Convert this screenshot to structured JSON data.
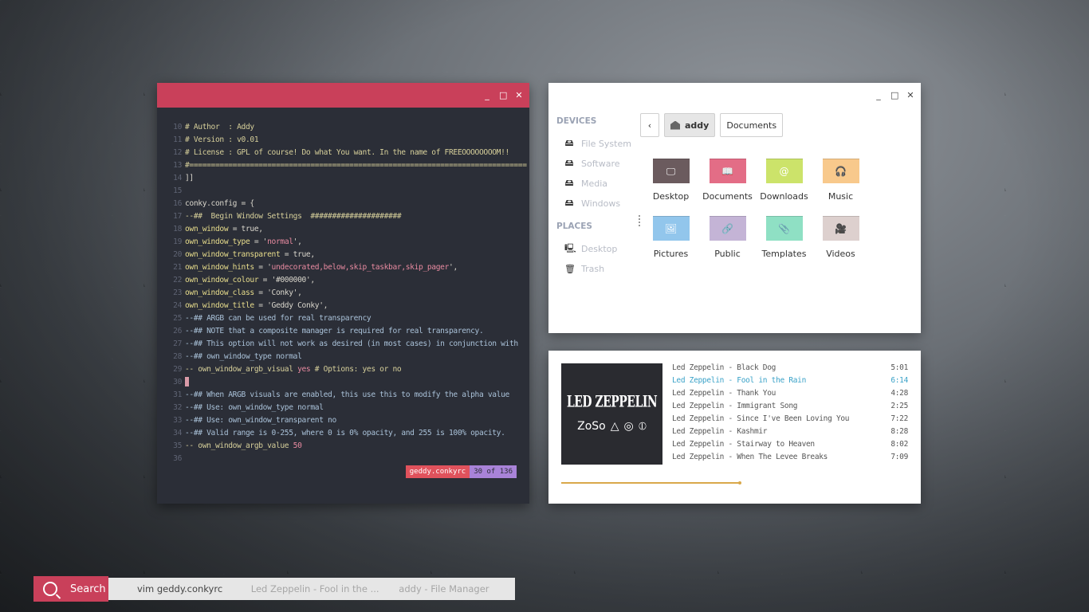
{
  "terminal": {
    "controls": {
      "min": "_",
      "max": "□",
      "close": "✕"
    },
    "lines": [
      {
        "n": "10",
        "parts": [
          {
            "c": "c-cmt",
            "t": "# Author  : Addy"
          }
        ]
      },
      {
        "n": "11",
        "parts": [
          {
            "c": "c-cmt",
            "t": "# Version : v0.01"
          }
        ]
      },
      {
        "n": "12",
        "parts": [
          {
            "c": "c-cmt",
            "t": "# License : GPL of course! Do what You want. In the name of FREEOOOOOOOOM!!"
          }
        ]
      },
      {
        "n": "13",
        "parts": [
          {
            "c": "c-cmt",
            "t": "#=============================================================================="
          }
        ]
      },
      {
        "n": "14",
        "parts": [
          {
            "c": "c-plain",
            "t": "]]"
          }
        ]
      },
      {
        "n": "15",
        "parts": []
      },
      {
        "n": "16",
        "parts": [
          {
            "c": "c-plain",
            "t": "conky.config = {"
          }
        ]
      },
      {
        "n": "17",
        "parts": [
          {
            "c": "c-cmt",
            "t": "--##  Begin Window Settings  #####################"
          }
        ]
      },
      {
        "n": "18",
        "parts": [
          {
            "c": "c-var",
            "t": "own_window"
          },
          {
            "c": "c-plain",
            "t": " = true,"
          }
        ]
      },
      {
        "n": "19",
        "parts": [
          {
            "c": "c-var",
            "t": "own_window_type"
          },
          {
            "c": "c-plain",
            "t": " = '"
          },
          {
            "c": "c-str",
            "t": "normal"
          },
          {
            "c": "c-plain",
            "t": "',"
          }
        ]
      },
      {
        "n": "20",
        "parts": [
          {
            "c": "c-var",
            "t": "own_window_transparent"
          },
          {
            "c": "c-plain",
            "t": " = true,"
          }
        ]
      },
      {
        "n": "21",
        "parts": [
          {
            "c": "c-var",
            "t": "own_window_hints"
          },
          {
            "c": "c-plain",
            "t": " = '"
          },
          {
            "c": "c-str",
            "t": "undecorated,below,skip_taskbar,skip_pager"
          },
          {
            "c": "c-plain",
            "t": "',"
          }
        ]
      },
      {
        "n": "22",
        "parts": [
          {
            "c": "c-var",
            "t": "own_window_colour"
          },
          {
            "c": "c-plain",
            "t": " = '#000000',"
          }
        ]
      },
      {
        "n": "23",
        "parts": [
          {
            "c": "c-var",
            "t": "own_window_class"
          },
          {
            "c": "c-plain",
            "t": " = 'Conky',"
          }
        ]
      },
      {
        "n": "24",
        "parts": [
          {
            "c": "c-var",
            "t": "own_window_title"
          },
          {
            "c": "c-plain",
            "t": " = 'Geddy Conky',"
          }
        ]
      },
      {
        "n": "25",
        "parts": [
          {
            "c": "c-cmt2",
            "t": "--## ARGB can be used for real transparency"
          }
        ]
      },
      {
        "n": "26",
        "parts": [
          {
            "c": "c-cmt2",
            "t": "--## NOTE that a composite manager is required for real transparency."
          }
        ]
      },
      {
        "n": "27",
        "parts": [
          {
            "c": "c-cmt2",
            "t": "--## This option will not work as desired (in most cases) in conjunction with"
          }
        ]
      },
      {
        "n": "28",
        "parts": [
          {
            "c": "c-cmt2",
            "t": "--## own_window_type normal"
          }
        ]
      },
      {
        "n": "29",
        "parts": [
          {
            "c": "c-cmt",
            "t": "-- own_window_argb_visual "
          },
          {
            "c": "c-str",
            "t": "yes"
          },
          {
            "c": "c-cmt",
            "t": " # Options: yes or no"
          }
        ]
      },
      {
        "n": "30",
        "cursor": true,
        "parts": []
      },
      {
        "n": "31",
        "parts": [
          {
            "c": "c-cmt2",
            "t": "--## When ARGB visuals are enabled, this use this to modify the alpha value"
          }
        ]
      },
      {
        "n": "32",
        "parts": [
          {
            "c": "c-cmt2",
            "t": "--## Use: own_window_type normal"
          }
        ]
      },
      {
        "n": "33",
        "parts": [
          {
            "c": "c-cmt2",
            "t": "--## Use: own_window_transparent no"
          }
        ]
      },
      {
        "n": "34",
        "parts": [
          {
            "c": "c-cmt2",
            "t": "--## Valid range is 0-255, where 0 is 0% opacity, and 255 is 100% opacity."
          }
        ]
      },
      {
        "n": "35",
        "parts": [
          {
            "c": "c-cmt",
            "t": "-- own_window_argb_value "
          },
          {
            "c": "c-str",
            "t": "50"
          }
        ]
      },
      {
        "n": "36",
        "parts": []
      }
    ],
    "status": {
      "filename": "geddy.conkyrc",
      "position": "30 of 136"
    }
  },
  "file_manager": {
    "controls": {
      "min": "_",
      "max": "□",
      "close": "✕"
    },
    "devices_heading": "DEVICES",
    "devices": [
      "File System",
      "Software",
      "Media",
      "Windows"
    ],
    "places_heading": "PLACES",
    "places": [
      {
        "label": "Desktop",
        "icon": "🖳"
      },
      {
        "label": "Trash",
        "icon": "🗑"
      }
    ],
    "path": {
      "back": "‹",
      "home": "addy",
      "current": "Documents"
    },
    "folders": [
      {
        "label": "Desktop",
        "color": "#6b5b5e",
        "icon": "🖵"
      },
      {
        "label": "Documents",
        "color": "#e36d86",
        "icon": "📖"
      },
      {
        "label": "Downloads",
        "color": "#cce36a",
        "icon": "@"
      },
      {
        "label": "Music",
        "color": "#f8c98c",
        "icon": "🎧"
      },
      {
        "label": "Pictures",
        "color": "#92c6ec",
        "icon": "🖼"
      },
      {
        "label": "Public",
        "color": "#c4b4d6",
        "icon": "🔗"
      },
      {
        "label": "Templates",
        "color": "#8fe0c4",
        "icon": "📎"
      },
      {
        "label": "Videos",
        "color": "#ddd0ce",
        "icon": "🎥"
      }
    ]
  },
  "music": {
    "cover": {
      "band": "LED ZEPPELIN",
      "symbols": [
        "ZoSo",
        "△",
        "◎",
        "⦶"
      ]
    },
    "tracks": [
      {
        "title": "Led Zeppelin - Black Dog",
        "time": "5:01",
        "playing": false
      },
      {
        "title": "Led Zeppelin - Fool in the Rain",
        "time": "6:14",
        "playing": true
      },
      {
        "title": "Led Zeppelin - Thank You",
        "time": "4:28",
        "playing": false
      },
      {
        "title": "Led Zeppelin - Immigrant Song",
        "time": "2:25",
        "playing": false
      },
      {
        "title": "Led Zeppelin - Since I've Been Loving You",
        "time": "7:22",
        "playing": false
      },
      {
        "title": "Led Zeppelin - Kashmir",
        "time": "8:28",
        "playing": false
      },
      {
        "title": "Led Zeppelin - Stairway to Heaven",
        "time": "8:02",
        "playing": false
      },
      {
        "title": "Led Zeppelin - When The Levee Breaks",
        "time": "7:09",
        "playing": false
      }
    ],
    "progress": 0.52,
    "progress_color": "#d9a84a"
  },
  "taskbar": {
    "search_label": "Search",
    "tasks": [
      "vim geddy.conkyrc",
      "Led Zeppelin - Fool in the ...",
      "addy - File Manager"
    ]
  },
  "colors": {
    "accent": "#c9405a",
    "terminal_bg": "#2b2e37"
  }
}
